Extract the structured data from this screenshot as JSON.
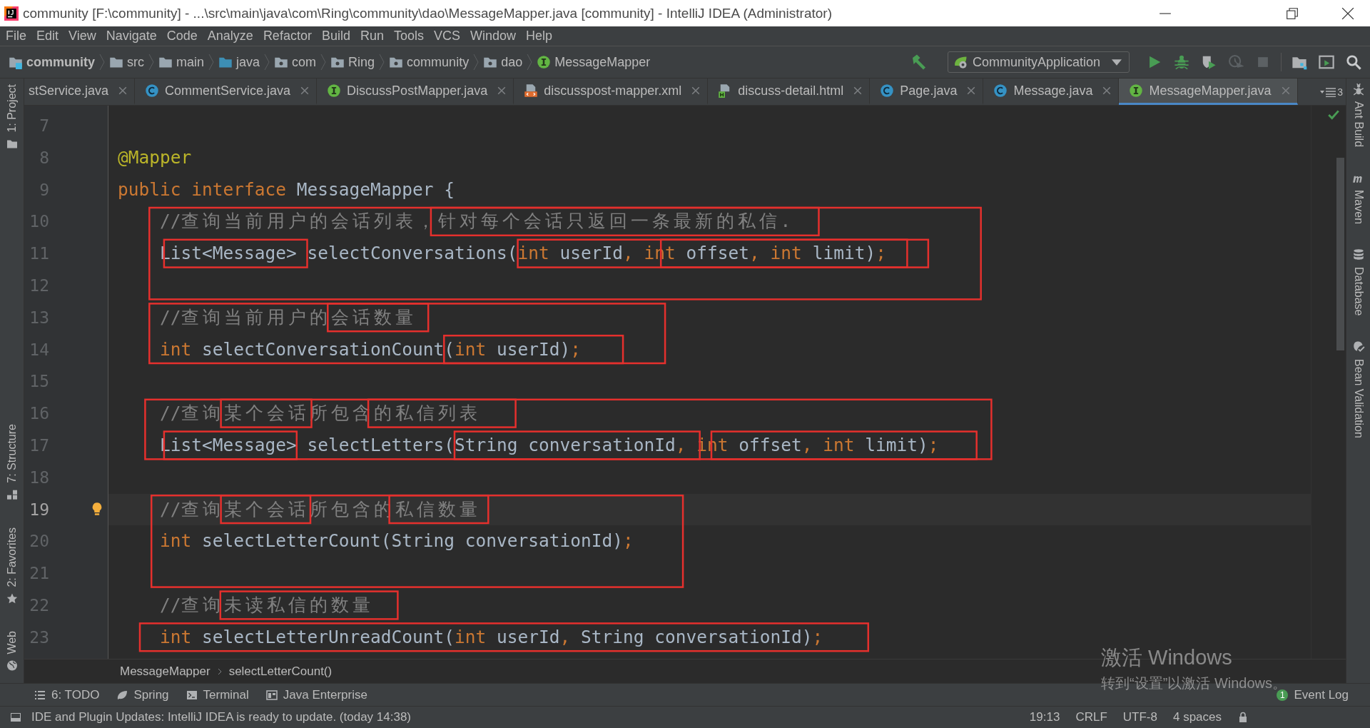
{
  "window": {
    "title": "community [F:\\community] - ...\\src\\main\\java\\com\\Ring\\community\\dao\\MessageMapper.java [community] - IntelliJ IDEA (Administrator)"
  },
  "menu": [
    "File",
    "Edit",
    "View",
    "Navigate",
    "Code",
    "Analyze",
    "Refactor",
    "Build",
    "Run",
    "Tools",
    "VCS",
    "Window",
    "Help"
  ],
  "breadcrumbs": [
    {
      "label": "community",
      "kind": "project"
    },
    {
      "label": "src",
      "kind": "folder"
    },
    {
      "label": "main",
      "kind": "folder"
    },
    {
      "label": "java",
      "kind": "source"
    },
    {
      "label": "com",
      "kind": "package"
    },
    {
      "label": "Ring",
      "kind": "package"
    },
    {
      "label": "community",
      "kind": "package"
    },
    {
      "label": "dao",
      "kind": "package"
    },
    {
      "label": "MessageMapper",
      "kind": "interface"
    }
  ],
  "run_config": {
    "label": "CommunityApplication"
  },
  "toolbar": [
    {
      "kind": "run",
      "disabled": false
    },
    {
      "kind": "debug",
      "disabled": false
    },
    {
      "kind": "coverage",
      "disabled": false
    },
    {
      "kind": "profile",
      "disabled": true
    },
    {
      "kind": "stop",
      "disabled": true
    }
  ],
  "tabs": [
    {
      "label": "stService.java",
      "kind": "clipped",
      "selected": false
    },
    {
      "label": "CommentService.java",
      "kind": "class",
      "selected": false
    },
    {
      "label": "DiscussPostMapper.java",
      "kind": "interface",
      "selected": false
    },
    {
      "label": "discusspost-mapper.xml",
      "kind": "xml",
      "selected": false
    },
    {
      "label": "discuss-detail.html",
      "kind": "html",
      "selected": false
    },
    {
      "label": "Page.java",
      "kind": "class",
      "selected": false
    },
    {
      "label": "Message.java",
      "kind": "class",
      "selected": false
    },
    {
      "label": "MessageMapper.java",
      "kind": "interface",
      "selected": true
    }
  ],
  "tab_overflow": {
    "count": "3"
  },
  "left_tools_top": [
    {
      "label": "1: Project",
      "kind": "project"
    }
  ],
  "left_tools_bottom": [
    {
      "label": "7: Structure",
      "kind": "structure"
    },
    {
      "label": "2: Favorites",
      "kind": "favorites"
    },
    {
      "label": "Web",
      "kind": "web"
    }
  ],
  "right_tools": [
    {
      "label": "Ant Build",
      "kind": "ant"
    },
    {
      "label": "Maven",
      "kind": "maven"
    },
    {
      "label": "Database",
      "kind": "database"
    },
    {
      "label": "Bean Validation",
      "kind": "bean"
    }
  ],
  "editor": {
    "lines": [
      {
        "number": "7",
        "current": false
      },
      {
        "number": "8",
        "current": false,
        "tokens": [
          {
            "kind": "annotation",
            "text": "@Mapper"
          }
        ]
      },
      {
        "number": "9",
        "current": false,
        "tokens": [
          {
            "kind": "keyword",
            "text": "public"
          },
          {
            "kind": "keyword",
            "text": " interface"
          },
          {
            "kind": "plain",
            "text": " MessageMapper {"
          }
        ]
      },
      {
        "number": "10",
        "current": false,
        "tokens": [
          {
            "kind": "comment",
            "text": "    //查询当前用户的会话列表，针对每个会话只返回一条最新的私信."
          }
        ]
      },
      {
        "number": "11",
        "current": false,
        "tokens": [
          {
            "kind": "plain",
            "text": "    List<Message> selectConversations("
          },
          {
            "kind": "keyword",
            "text": "int"
          },
          {
            "kind": "plain",
            "text": " userId"
          },
          {
            "kind": "punct",
            "text": ","
          },
          {
            "kind": "keyword",
            "text": " int"
          },
          {
            "kind": "plain",
            "text": " offset"
          },
          {
            "kind": "punct",
            "text": ","
          },
          {
            "kind": "keyword",
            "text": " int"
          },
          {
            "kind": "plain",
            "text": " limit)"
          },
          {
            "kind": "punct",
            "text": ";"
          }
        ]
      },
      {
        "number": "12",
        "current": false
      },
      {
        "number": "13",
        "current": false,
        "tokens": [
          {
            "kind": "comment",
            "text": "    //查询当前用户的会话数量"
          }
        ]
      },
      {
        "number": "14",
        "current": false,
        "tokens": [
          {
            "kind": "keyword",
            "text": "    int"
          },
          {
            "kind": "plain",
            "text": " selectConversationCount("
          },
          {
            "kind": "keyword",
            "text": "int"
          },
          {
            "kind": "plain",
            "text": " userId)"
          },
          {
            "kind": "punct",
            "text": ";"
          }
        ]
      },
      {
        "number": "15",
        "current": false
      },
      {
        "number": "16",
        "current": false,
        "tokens": [
          {
            "kind": "comment",
            "text": "    //查询某个会话所包含的私信列表"
          }
        ]
      },
      {
        "number": "17",
        "current": false,
        "tokens": [
          {
            "kind": "plain",
            "text": "    List<Message> selectLetters(String conversationId"
          },
          {
            "kind": "punct",
            "text": ","
          },
          {
            "kind": "keyword",
            "text": " int"
          },
          {
            "kind": "plain",
            "text": " offset"
          },
          {
            "kind": "punct",
            "text": ","
          },
          {
            "kind": "keyword",
            "text": " int"
          },
          {
            "kind": "plain",
            "text": " limit)"
          },
          {
            "kind": "punct",
            "text": ";"
          }
        ]
      },
      {
        "number": "18",
        "current": false
      },
      {
        "number": "19",
        "current": true,
        "bulb": true,
        "tokens": [
          {
            "kind": "comment",
            "text": "    //查询某个会话所包含的私信数量"
          }
        ]
      },
      {
        "number": "20",
        "current": false,
        "tokens": [
          {
            "kind": "keyword",
            "text": "    int"
          },
          {
            "kind": "plain",
            "text": " selectLetterCount(String conversationId)"
          },
          {
            "kind": "punct",
            "text": ";"
          }
        ]
      },
      {
        "number": "21",
        "current": false
      },
      {
        "number": "22",
        "current": false,
        "tokens": [
          {
            "kind": "comment",
            "text": "    //查询未读私信的数量"
          }
        ]
      },
      {
        "number": "23",
        "current": false,
        "tokens": [
          {
            "kind": "keyword",
            "text": "    int"
          },
          {
            "kind": "plain",
            "text": " selectLetterUnreadCount("
          },
          {
            "kind": "keyword",
            "text": "int"
          },
          {
            "kind": "plain",
            "text": " userId"
          },
          {
            "kind": "punct",
            "text": ","
          },
          {
            "kind": "plain",
            "text": " String conversationId)"
          },
          {
            "kind": "punct",
            "text": ";"
          }
        ]
      }
    ]
  },
  "editor_breadcrumb": [
    "MessageMapper",
    "selectLetterCount()"
  ],
  "tool_windows": [
    {
      "label": "6: TODO",
      "kind": "todo"
    },
    {
      "label": "Spring",
      "kind": "spring"
    },
    {
      "label": "Terminal",
      "kind": "terminal"
    },
    {
      "label": "Java Enterprise",
      "kind": "javaee"
    }
  ],
  "event_log": {
    "label": "Event Log",
    "count": "1"
  },
  "status_bar": {
    "message": "IDE and Plugin Updates: IntelliJ IDEA is ready to update. (today 14:38)",
    "items": [
      "19:13",
      "CRLF",
      "UTF-8",
      "4 spaces"
    ]
  },
  "os_notice": {
    "title": "激活 Windows",
    "text": "转到“设置”以激活 Windows。"
  }
}
